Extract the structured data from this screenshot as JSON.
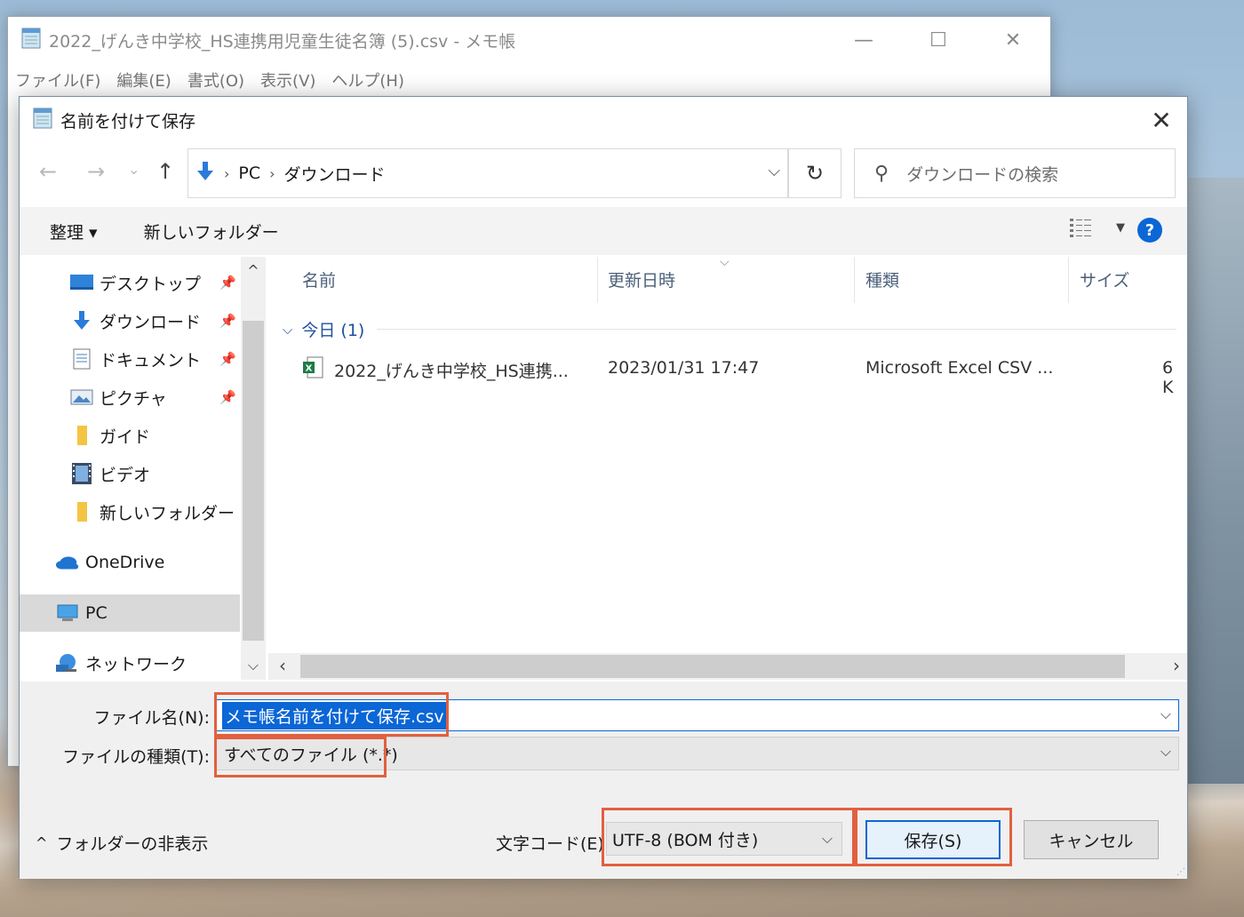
{
  "notepad": {
    "title": "2022_げんき中学校_HS連携用児童生徒名簿 (5).csv - メモ帳",
    "menu": [
      "ファイル(F)",
      "編集(E)",
      "書式(O)",
      "表示(V)",
      "ヘルプ(H)"
    ],
    "controls": {
      "minimize": "—",
      "maximize": "☐",
      "close": "✕"
    }
  },
  "dialog": {
    "title": "名前を付けて保存",
    "close": "✕",
    "nav": {
      "back": "←",
      "forward": "→",
      "recent": "⌄",
      "up": "↑"
    },
    "breadcrumb": [
      "PC",
      "ダウンロード"
    ],
    "refresh": "↻",
    "search_placeholder": "ダウンロードの検索",
    "toolbar": {
      "organize": "整理 ▾",
      "new_folder": "新しいフォルダー",
      "help": "?"
    },
    "tree": [
      {
        "label": "デスクトップ",
        "icon": "desktop-icon",
        "pinned": true
      },
      {
        "label": "ダウンロード",
        "icon": "download-icon",
        "pinned": true
      },
      {
        "label": "ドキュメント",
        "icon": "document-icon",
        "pinned": true
      },
      {
        "label": "ピクチャ",
        "icon": "picture-icon",
        "pinned": true
      },
      {
        "label": "ガイド",
        "icon": "folder-icon",
        "pinned": false
      },
      {
        "label": "ビデオ",
        "icon": "video-icon",
        "pinned": false
      },
      {
        "label": "新しいフォルダー",
        "icon": "folder-icon",
        "pinned": false
      },
      {
        "label": "OneDrive",
        "icon": "onedrive-icon",
        "pinned": false
      },
      {
        "label": "PC",
        "icon": "pc-icon",
        "pinned": false,
        "selected": true
      },
      {
        "label": "ネットワーク",
        "icon": "network-icon",
        "pinned": false
      }
    ],
    "columns": [
      "名前",
      "更新日時",
      "種類",
      "サイズ"
    ],
    "group": "今日 (1)",
    "files": [
      {
        "name": "2022_げんき中学校_HS連携...",
        "modified": "2023/01/31 17:47",
        "type": "Microsoft Excel CSV ...",
        "size": "6 K"
      }
    ],
    "filename_label": "ファイル名(N):",
    "filename_value": "メモ帳名前を付けて保存.csv",
    "filetype_label": "ファイルの種類(T):",
    "filetype_value": "すべてのファイル  (*.*)",
    "hide_folders": "フォルダーの非表示",
    "encoding_label": "文字コード(E):",
    "encoding_value": "UTF-8 (BOM 付き)",
    "save": "保存(S)",
    "cancel": "キャンセル"
  },
  "colors": {
    "accent": "#0b66d6",
    "highlight": "#e2603f",
    "group_text": "#1f4e9a"
  }
}
